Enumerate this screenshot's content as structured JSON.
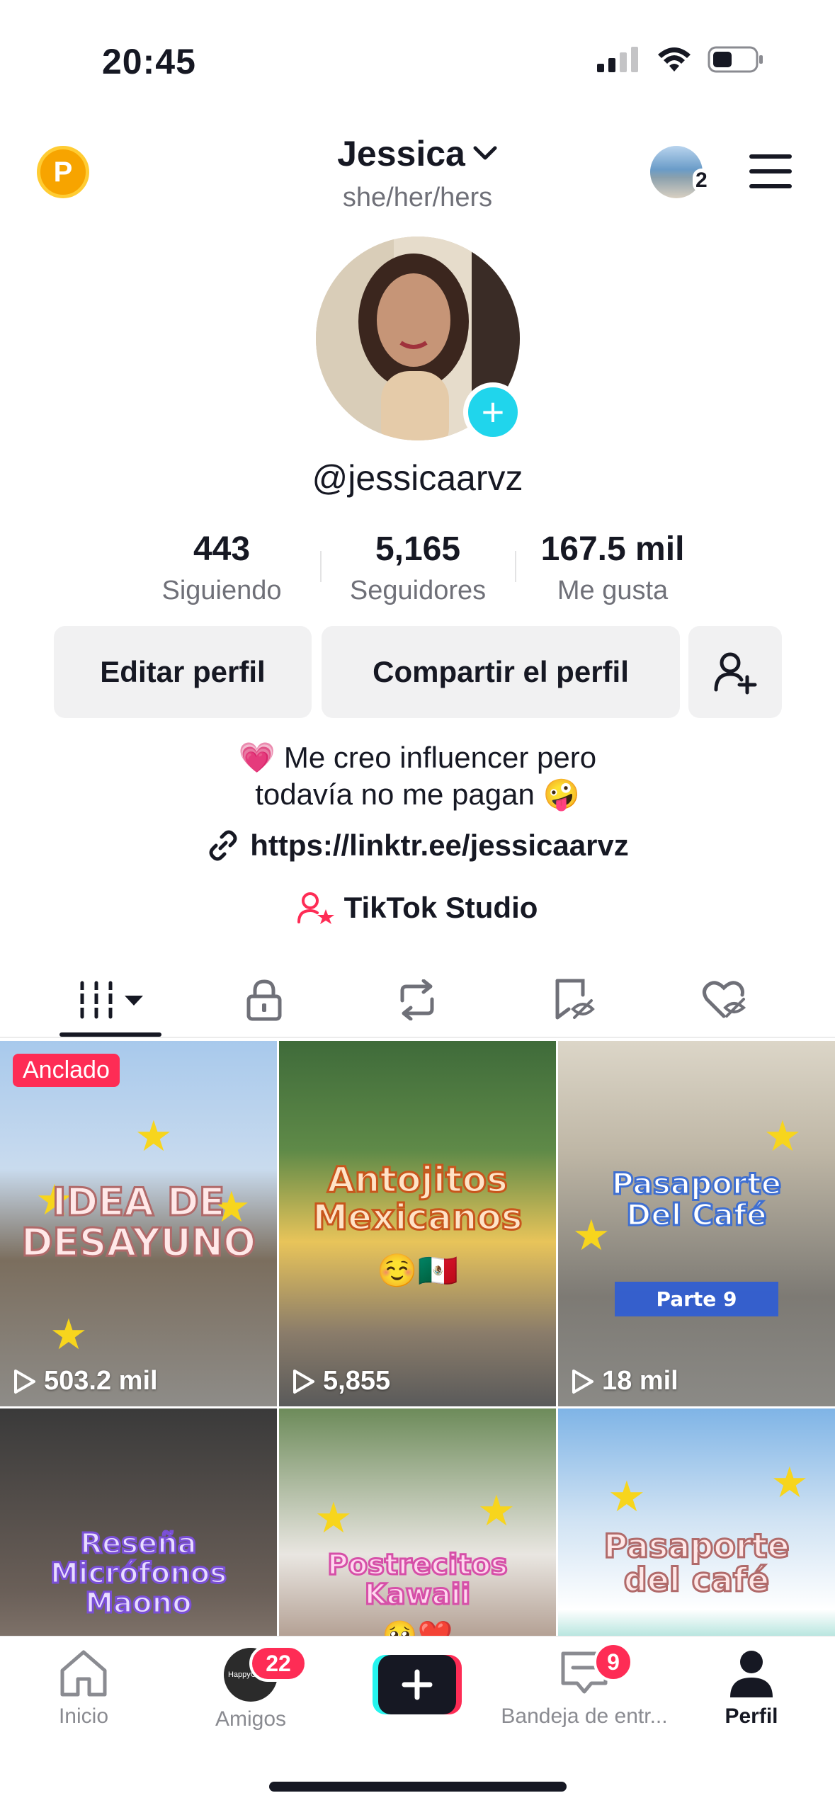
{
  "status_bar": {
    "time": "20:45"
  },
  "header": {
    "username": "Jessica",
    "pronouns": "she/her/hers",
    "points_icon": "P",
    "story_count": "2"
  },
  "profile": {
    "handle": "@jessicaarvz",
    "stats": [
      {
        "value": "443",
        "label": "Siguiendo"
      },
      {
        "value": "5,165",
        "label": "Seguidores"
      },
      {
        "value": "167.5 mil",
        "label": "Me gusta"
      }
    ],
    "buttons": {
      "edit": "Editar perfil",
      "share": "Compartir el perfil"
    },
    "bio_line1": "Me creo influencer pero",
    "bio_line2": "todavía no me pagan",
    "bio_emoji1": "💗",
    "bio_emoji2": "🤪",
    "link": "https://linktr.ee/jessicaarvz",
    "studio": "TikTok Studio"
  },
  "grid": {
    "pinned_label": "Anclado",
    "videos": [
      {
        "title": "IDEA DE DESAYUNO",
        "views": "503.2 mil"
      },
      {
        "title": "Antojitos Mexicanos",
        "emoji": "☺️🇲🇽",
        "views": "5,855"
      },
      {
        "title": "Pasaporte Del Café",
        "subtitle": "Parte 9",
        "views": "18 mil"
      },
      {
        "title": "Reseña Micrófonos Maono"
      },
      {
        "title": "Postrecitos Kawaii",
        "emoji": "🥺❤️"
      },
      {
        "title": "Pasaporte del café"
      }
    ]
  },
  "bottom_nav": {
    "items": [
      {
        "label": "Inicio"
      },
      {
        "label": "Amigos",
        "badge": "22",
        "avatar_text": "HappyCoffee"
      },
      {
        "label": "Bandeja de entr...",
        "badge": "9"
      },
      {
        "label": "Perfil"
      }
    ]
  },
  "colors": {
    "accent": "#fe2c55",
    "cyan": "#20d5ec",
    "text": "#161823",
    "muted": "#6f7078"
  }
}
